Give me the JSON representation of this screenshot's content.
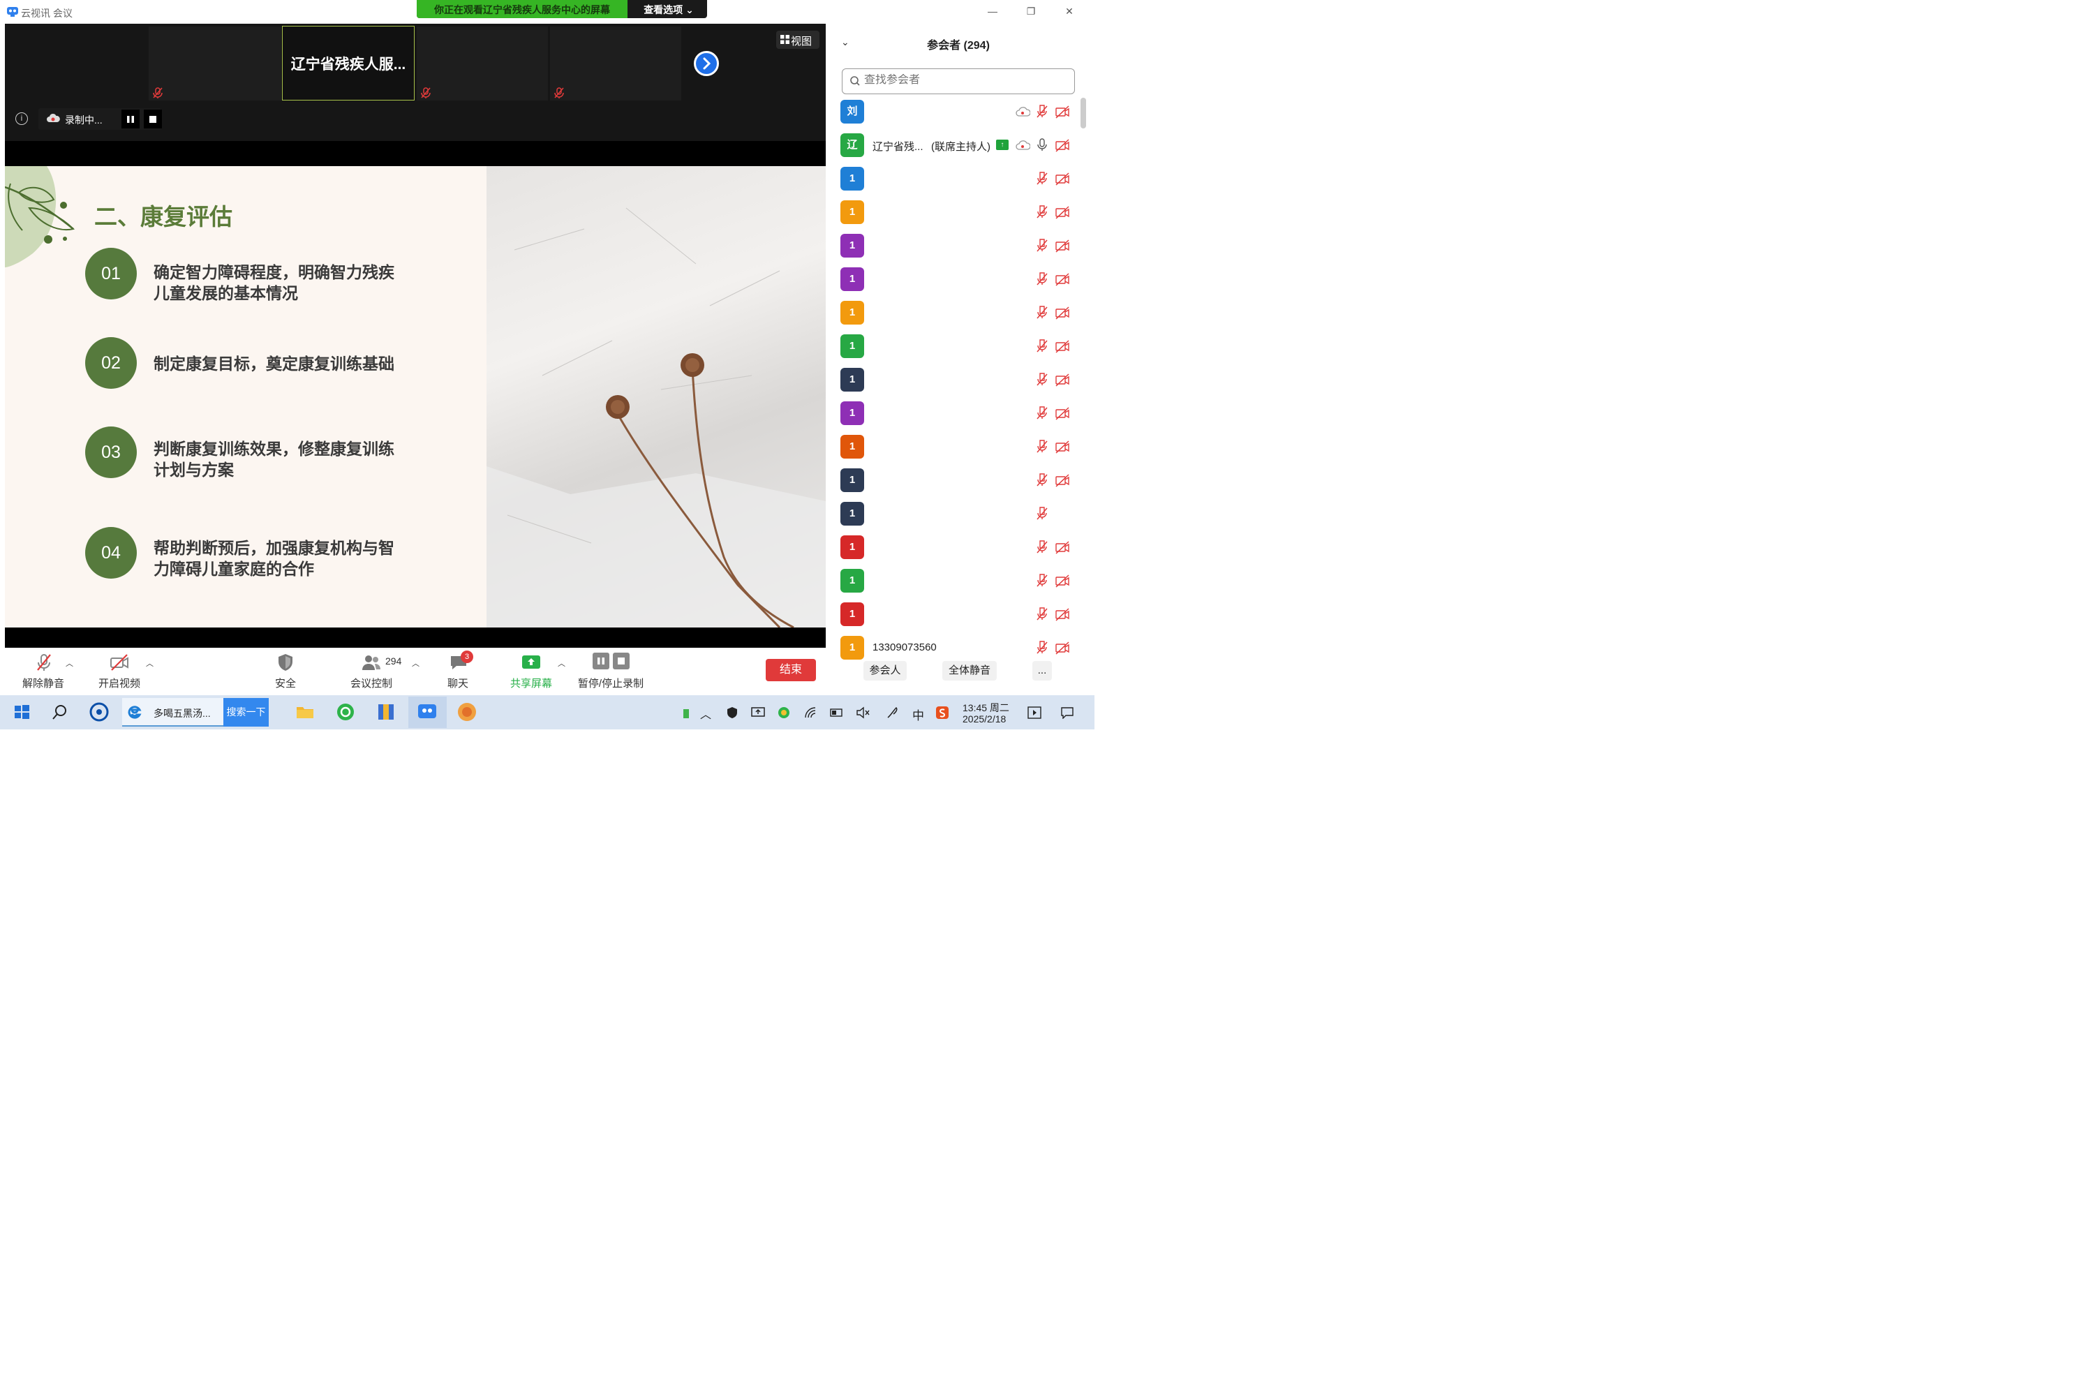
{
  "window": {
    "title": "云视讯 会议",
    "share_banner": "你正在观看辽宁省残疾人服务中心的屏幕",
    "view_options": "查看选项 ⌄",
    "minimize": "—",
    "restore": "❐",
    "close": "✕"
  },
  "video_strip": {
    "host_tile_name": "辽宁省残疾人服...",
    "view_label": "视图",
    "recording_label": "录制中...",
    "info_glyph": "i"
  },
  "slide": {
    "title": "二、康复评估",
    "points": [
      {
        "num": "01",
        "line1": "确定智力障碍程度，明确智力残疾",
        "line2": "儿童发展的基本情况"
      },
      {
        "num": "02",
        "line1": "制定康复目标，奠定康复训练基础",
        "line2": ""
      },
      {
        "num": "03",
        "line1": "判断康复训练效果，修整康复训练",
        "line2": "计划与方案"
      },
      {
        "num": "04",
        "line1": "帮助判断预后，加强康复机构与智",
        "line2": "力障碍儿童家庭的合作"
      }
    ]
  },
  "toolbar": {
    "unmute": "解除静音",
    "start_video": "开启视频",
    "security": "安全",
    "participant_count": "294",
    "meeting_control": "会议控制",
    "chat": "聊天",
    "chat_badge": "3",
    "share_screen": "共享屏幕",
    "pause_stop_record": "暂停/停止录制",
    "end": "结束"
  },
  "sidebar": {
    "title": "参会者 (294)",
    "search_placeholder": "查找参会者",
    "participants": [
      {
        "initial": "刘",
        "color": "#1f7fd6",
        "name": "",
        "role": ""
      },
      {
        "initial": "辽",
        "color": "#27a844",
        "name": "辽宁省残...",
        "role": "(联席主持人)"
      },
      {
        "initial": "1",
        "color": "#1f7fd6",
        "name": "",
        "role": ""
      },
      {
        "initial": "1",
        "color": "#f29a0e",
        "name": "",
        "role": ""
      },
      {
        "initial": "1",
        "color": "#8e2fb5",
        "name": "",
        "role": ""
      },
      {
        "initial": "1",
        "color": "#8e2fb5",
        "name": "",
        "role": ""
      },
      {
        "initial": "1",
        "color": "#f29a0e",
        "name": "",
        "role": ""
      },
      {
        "initial": "1",
        "color": "#27a844",
        "name": "",
        "role": ""
      },
      {
        "initial": "1",
        "color": "#2d3b55",
        "name": "",
        "role": ""
      },
      {
        "initial": "1",
        "color": "#8e2fb5",
        "name": "",
        "role": ""
      },
      {
        "initial": "1",
        "color": "#e0560a",
        "name": "",
        "role": ""
      },
      {
        "initial": "1",
        "color": "#2d3b55",
        "name": "",
        "role": ""
      },
      {
        "initial": "1",
        "color": "#2d3b55",
        "name": "",
        "role": ""
      },
      {
        "initial": "1",
        "color": "#d62828",
        "name": "",
        "role": ""
      },
      {
        "initial": "1",
        "color": "#27a844",
        "name": "",
        "role": ""
      },
      {
        "initial": "1",
        "color": "#d62828",
        "name": "",
        "role": ""
      },
      {
        "initial": "1",
        "color": "#f29a0e",
        "name": "13309073560",
        "role": ""
      }
    ],
    "btn_participants": "参会人",
    "btn_mute_all": "全体静音",
    "btn_more": "..."
  },
  "taskbar": {
    "ie_label": "多喝五黑汤...",
    "search_label": "搜索一下",
    "ime": "中",
    "time": "13:45 周二",
    "date": "2025/2/18"
  },
  "colors": {
    "accent_green": "#36b524",
    "slide_green": "#567a3d",
    "end_red": "#e03a3a",
    "muted_red": "#e03a3a"
  }
}
